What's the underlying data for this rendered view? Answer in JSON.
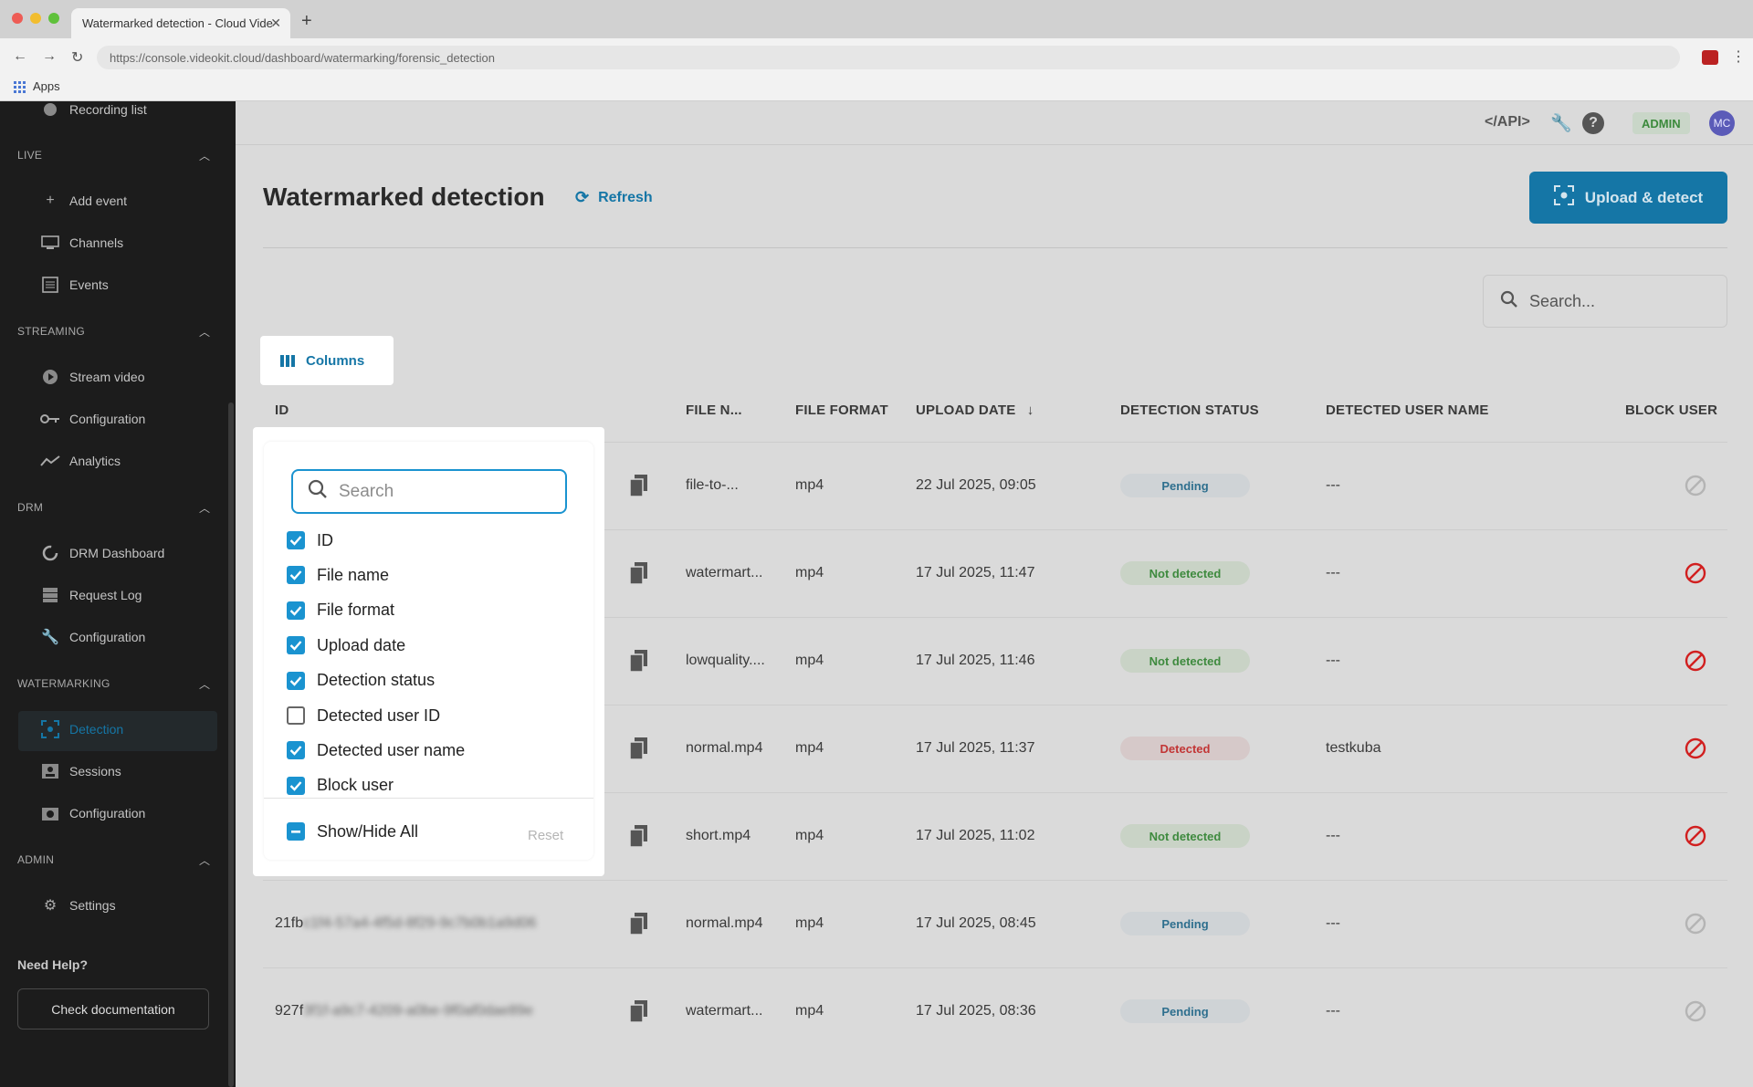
{
  "browser": {
    "tab_title": "Watermarked detection - Cloud Vide",
    "url": "https://console.videokit.cloud/dashboard/watermarking/forensic_detection",
    "bookmarks_apps": "Apps"
  },
  "sidebar": {
    "top_item": "Recording list",
    "sections": [
      {
        "title": "LIVE",
        "items": [
          "Add event",
          "Channels",
          "Events"
        ]
      },
      {
        "title": "STREAMING",
        "items": [
          "Stream video",
          "Configuration",
          "Analytics"
        ]
      },
      {
        "title": "DRM",
        "items": [
          "DRM Dashboard",
          "Request Log",
          "Configuration"
        ]
      },
      {
        "title": "WATERMARKING",
        "items": [
          "Detection",
          "Sessions",
          "Configuration"
        ]
      },
      {
        "title": "ADMIN",
        "items": [
          "Settings"
        ]
      }
    ],
    "need_help": "Need Help?",
    "doc_button": "Check documentation"
  },
  "topbar": {
    "api_label": "</API>",
    "role_badge": "ADMIN",
    "avatar": "MC"
  },
  "page": {
    "title": "Watermarked detection",
    "refresh_label": "Refresh",
    "upload_label": "Upload & detect",
    "search_placeholder": "Search...",
    "columns_label": "Columns"
  },
  "table": {
    "headers": [
      "ID",
      "FILE N...",
      "FILE FORMAT",
      "UPLOAD DATE",
      "DETECTION STATUS",
      "DETECTED USER NAME",
      "BLOCK USER"
    ],
    "rows": [
      {
        "id": "",
        "id_tail": "",
        "file": "file-to-...",
        "format": "mp4",
        "date": "22 Jul 2025, 09:05",
        "status": "Pending",
        "user": "---",
        "blockable": false
      },
      {
        "id": "",
        "id_tail": "",
        "file": "watermart...",
        "format": "mp4",
        "date": "17 Jul 2025, 11:47",
        "status": "Not detected",
        "user": "---",
        "blockable": true
      },
      {
        "id": "",
        "id_tail": "",
        "file": "lowquality....",
        "format": "mp4",
        "date": "17 Jul 2025, 11:46",
        "status": "Not detected",
        "user": "---",
        "blockable": true
      },
      {
        "id": "",
        "id_tail": "",
        "file": "normal.mp4",
        "format": "mp4",
        "date": "17 Jul 2025, 11:37",
        "status": "Detected",
        "user": "testkuba",
        "blockable": true
      },
      {
        "id": "",
        "id_tail": "",
        "file": "short.mp4",
        "format": "mp4",
        "date": "17 Jul 2025, 11:02",
        "status": "Not detected",
        "user": "---",
        "blockable": true
      },
      {
        "id": "21fb",
        "id_tail": "c1f4-57a4-4f5d-8f29-9c7b0b1a9d06",
        "file": "normal.mp4",
        "format": "mp4",
        "date": "17 Jul 2025, 08:45",
        "status": "Pending",
        "user": "---",
        "blockable": false
      },
      {
        "id": "927f",
        "id_tail": "3f1f-a9c7-4209-a0be-9f0af0dae89e",
        "file": "watermart...",
        "format": "mp4",
        "date": "17 Jul 2025, 08:36",
        "status": "Pending",
        "user": "---",
        "blockable": false
      }
    ]
  },
  "columns_popover": {
    "search_placeholder": "Search",
    "options": [
      {
        "label": "ID",
        "checked": true
      },
      {
        "label": "File name",
        "checked": true
      },
      {
        "label": "File format",
        "checked": true
      },
      {
        "label": "Upload date",
        "checked": true
      },
      {
        "label": "Detection status",
        "checked": true
      },
      {
        "label": "Detected user ID",
        "checked": false
      },
      {
        "label": "Detected user name",
        "checked": true
      },
      {
        "label": "Block user",
        "checked": true
      }
    ],
    "toggle_all_label": "Show/Hide All",
    "reset_label": "Reset"
  },
  "colors": {
    "accent": "#1576a6",
    "checkbox": "#1a93d0",
    "sidebar_bg": "#1c1c1c",
    "detected": "#c23535",
    "not_detected": "#3e8a3e"
  }
}
